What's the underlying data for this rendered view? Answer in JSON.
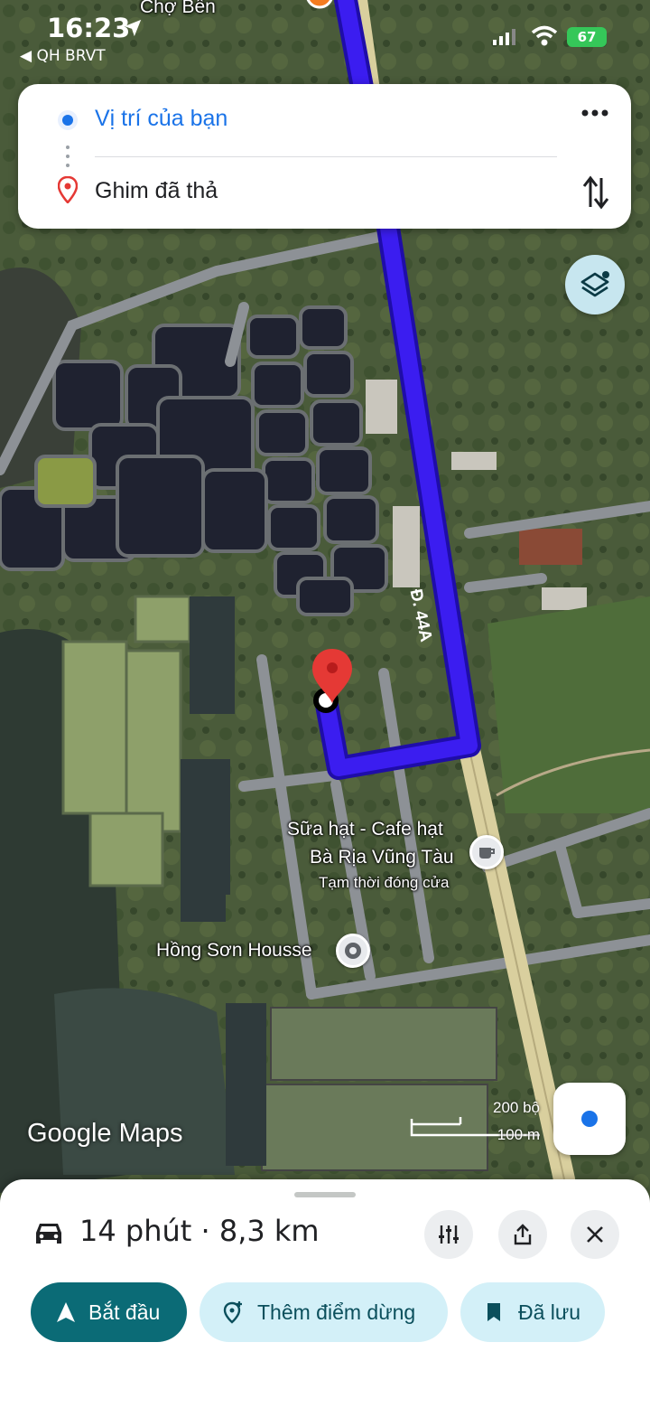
{
  "status_bar": {
    "time": "16:23",
    "back_app": "◀ QH BRVT",
    "battery": "67"
  },
  "directions": {
    "from": "Vị trí của bạn",
    "to": "Ghim đã thả"
  },
  "map": {
    "road_label": "Đ. 44A",
    "top_place": "Chợ Bến",
    "poi_cafe_line1": "Sữa hạt - Cafe hạt",
    "poi_cafe_line2": "Bà Rịa Vũng Tàu",
    "poi_cafe_status": "Tạm thời đóng cửa",
    "poi_house": "Hồng Sơn Housse",
    "scale_feet": "200 bộ",
    "scale_meters": "100 m",
    "logo": "Google Maps",
    "route_color": "#3b1df0",
    "pin_color": "#e53935"
  },
  "sheet": {
    "summary": "14 phút · 8,3 km",
    "start": "Bắt đầu",
    "add_stop": "Thêm điểm dừng",
    "saved": "Đã lưu",
    "accent": "#0b6b76"
  }
}
